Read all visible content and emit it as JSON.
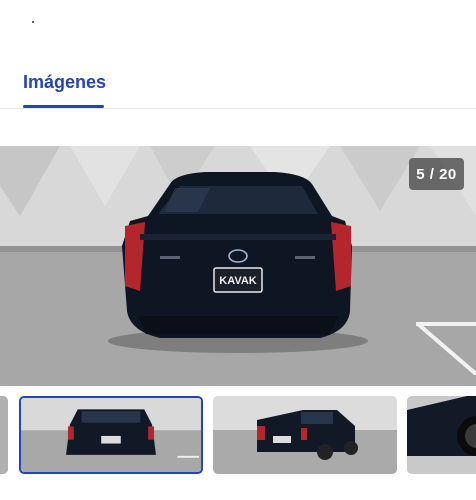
{
  "tabs": {
    "active_label": "Imágenes"
  },
  "gallery": {
    "counter": "5 / 20",
    "main_image": {
      "plate_text": "KAVAK"
    },
    "thumbnails": [
      {
        "label": "thumb-4"
      },
      {
        "label": "thumb-5",
        "selected": true
      },
      {
        "label": "thumb-6"
      },
      {
        "label": "thumb-7"
      }
    ]
  },
  "colors": {
    "accent": "#2346b5",
    "car": "#0f1623",
    "counter_bg": "#3c3c3c"
  }
}
